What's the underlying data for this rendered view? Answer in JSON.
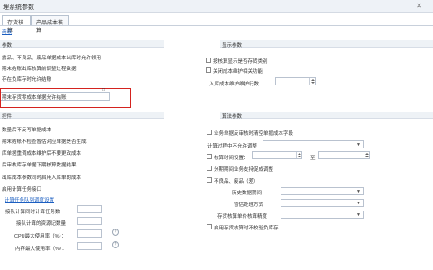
{
  "window": {
    "title": "理系统参数"
  },
  "tabs": [
    "存货核算",
    "产品成本核算"
  ],
  "top_link": "高级",
  "sections": {
    "left_top": "参数",
    "right_top": "显示参数",
    "left_bottom": "控件",
    "right_bottom": "算法参数"
  },
  "left_top_items": [
    "露品、不良品、废品单据成本出库时允许领用",
    "期末结账出库核算前调整过程数据",
    "存在负库存时允许结账",
    "期末存货零成本单据允许结账"
  ],
  "right_top_items": [
    "按核算显示是否存货类别",
    "关闭成本维护相关功能",
    "入库成本维护维护行数"
  ],
  "left_bottom_items": [
    "数量后不反写单据成本",
    "期末结账不检查暂估对应单据是否生成",
    "库单据重调成本维护后不要更改成本",
    "后审核库存单据下期核算数据结果",
    "出库成本参数同时启用入库单的成本",
    "启用计算任务接口"
  ],
  "left_bottom_link": "计算任务队列调度设置",
  "left_bottom_fields": [
    {
      "label": "接队计算同时计算任务数",
      "value": ""
    },
    {
      "label": "接队计算的资源记数量",
      "value": ""
    },
    {
      "label": "CPU最大使用率（%）：",
      "value": ""
    },
    {
      "label": "内存最大使用率（%）：",
      "value": ""
    }
  ],
  "right_bottom_items": [
    "业务单据反审核时清空单据成本字段",
    "计算过程中不允许调整",
    "核算时间设置：",
    "分期期间业务支持促成调整",
    "不良品、废品（差）",
    "历史数据期间",
    "暂估处理方式",
    "存货核算单价核算精度",
    "启用存货核算时不校验负库存"
  ],
  "right_bottom_labels": {
    "to": "至",
    "calc_mode": "计算模式"
  },
  "colors": {
    "accent": "#1c5fc1",
    "highlight": "#d4231f"
  }
}
